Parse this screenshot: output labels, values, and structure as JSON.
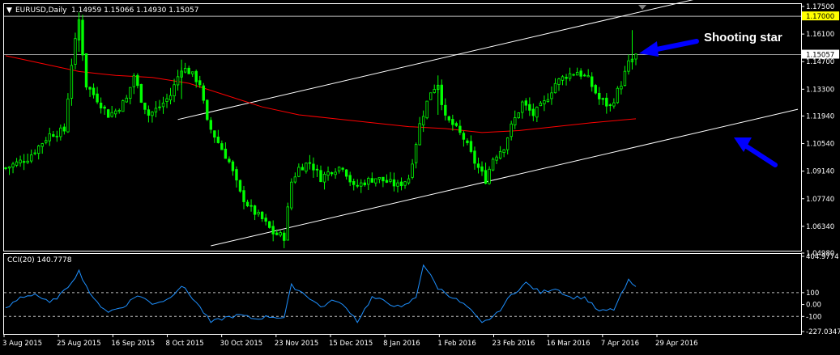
{
  "header": {
    "symbol": "EURUSD,Daily",
    "ohlc": "1.14959 1.15066 1.14930 1.15057"
  },
  "indicator": {
    "label": "CCI(20) 140.7778"
  },
  "annotation": {
    "text": "Shooting star"
  },
  "colors": {
    "background": "#000000",
    "candle": "#00ff00",
    "moving_average": "#ff0000",
    "cci_line": "#1e90ff",
    "channel": "#ffffff",
    "arrow": "#0000ff",
    "current_price_bg": "#ffffff",
    "level_price_bg": "#ffff00"
  },
  "chart_data": [
    {
      "type": "candlestick",
      "y_ticks": [
        "1.17500",
        "1.16100",
        "1.14700",
        "1.13300",
        "1.11940",
        "1.10540",
        "1.09140",
        "1.07740",
        "1.06340",
        "1.04980"
      ],
      "y_tick_values": [
        1.175,
        1.161,
        1.147,
        1.133,
        1.1194,
        1.1054,
        1.0914,
        1.0774,
        1.0634,
        1.0498
      ],
      "ylim": [
        1.0498,
        1.175
      ],
      "x_ticks": [
        "3 Aug 2015",
        "25 Aug 2015",
        "16 Sep 2015",
        "8 Oct 2015",
        "30 Oct 2015",
        "23 Nov 2015",
        "15 Dec 2015",
        "8 Jan 2016",
        "1 Feb 2016",
        "23 Feb 2016",
        "16 Mar 2016",
        "7 Apr 2016",
        "29 Apr 2016"
      ],
      "current_price": {
        "label": "1.15057",
        "value": 1.15057
      },
      "level_line": {
        "label": "1.17000",
        "value": 1.17
      },
      "price_path": [
        [
          0,
          1.093
        ],
        [
          6,
          1.098
        ],
        [
          12,
          1.11
        ],
        [
          16,
          1.112
        ],
        [
          18,
          1.146
        ],
        [
          20,
          1.168
        ],
        [
          22,
          1.135
        ],
        [
          25,
          1.128
        ],
        [
          28,
          1.12
        ],
        [
          30,
          1.122
        ],
        [
          33,
          1.128
        ],
        [
          35,
          1.14
        ],
        [
          37,
          1.128
        ],
        [
          39,
          1.12
        ],
        [
          42,
          1.124
        ],
        [
          45,
          1.13
        ],
        [
          48,
          1.144
        ],
        [
          50,
          1.142
        ],
        [
          53,
          1.136
        ],
        [
          55,
          1.116
        ],
        [
          58,
          1.106
        ],
        [
          61,
          1.096
        ],
        [
          64,
          1.08
        ],
        [
          67,
          1.072
        ],
        [
          70,
          1.067
        ],
        [
          73,
          1.06
        ],
        [
          76,
          1.058
        ],
        [
          78,
          1.086
        ],
        [
          80,
          1.093
        ],
        [
          83,
          1.096
        ],
        [
          86,
          1.088
        ],
        [
          89,
          1.092
        ],
        [
          92,
          1.094
        ],
        [
          95,
          1.083
        ],
        [
          98,
          1.086
        ],
        [
          101,
          1.088
        ],
        [
          104,
          1.086
        ],
        [
          107,
          1.084
        ],
        [
          110,
          1.088
        ],
        [
          113,
          1.115
        ],
        [
          116,
          1.132
        ],
        [
          118,
          1.136
        ],
        [
          120,
          1.118
        ],
        [
          122,
          1.115
        ],
        [
          125,
          1.108
        ],
        [
          128,
          1.096
        ],
        [
          131,
          1.087
        ],
        [
          133,
          1.098
        ],
        [
          136,
          1.104
        ],
        [
          138,
          1.114
        ],
        [
          141,
          1.126
        ],
        [
          144,
          1.12
        ],
        [
          147,
          1.126
        ],
        [
          150,
          1.136
        ],
        [
          153,
          1.14
        ],
        [
          156,
          1.142
        ],
        [
          159,
          1.138
        ],
        [
          162,
          1.128
        ],
        [
          165,
          1.124
        ],
        [
          168,
          1.136
        ],
        [
          170,
          1.146
        ],
        [
          172,
          1.15
        ]
      ],
      "moving_average_path": [
        [
          0,
          1.15
        ],
        [
          10,
          1.146
        ],
        [
          20,
          1.142
        ],
        [
          30,
          1.14
        ],
        [
          40,
          1.139
        ],
        [
          50,
          1.136
        ],
        [
          60,
          1.13
        ],
        [
          70,
          1.124
        ],
        [
          80,
          1.12
        ],
        [
          90,
          1.118
        ],
        [
          100,
          1.116
        ],
        [
          110,
          1.114
        ],
        [
          120,
          1.113
        ],
        [
          130,
          1.111
        ],
        [
          140,
          1.112
        ],
        [
          150,
          1.114
        ],
        [
          160,
          1.116
        ],
        [
          172,
          1.118
        ]
      ]
    },
    {
      "type": "line",
      "name": "CCI(20)",
      "y_ticks": [
        "404.9774",
        "100",
        "0.00",
        "-100",
        "-227.0347"
      ],
      "y_tick_values": [
        404.9774,
        100,
        0,
        -100,
        -227.0347
      ],
      "ylim": [
        -227.0347,
        404.9774
      ],
      "dashed_levels": [
        100,
        -100
      ],
      "path": [
        [
          0,
          -40
        ],
        [
          4,
          60
        ],
        [
          8,
          90
        ],
        [
          12,
          10
        ],
        [
          16,
          110
        ],
        [
          20,
          280
        ],
        [
          24,
          40
        ],
        [
          28,
          -60
        ],
        [
          32,
          -20
        ],
        [
          36,
          80
        ],
        [
          40,
          10
        ],
        [
          44,
          40
        ],
        [
          48,
          160
        ],
        [
          52,
          20
        ],
        [
          56,
          -150
        ],
        [
          60,
          -110
        ],
        [
          64,
          -90
        ],
        [
          68,
          -120
        ],
        [
          72,
          -100
        ],
        [
          76,
          -110
        ],
        [
          78,
          160
        ],
        [
          82,
          80
        ],
        [
          86,
          -20
        ],
        [
          90,
          40
        ],
        [
          94,
          -60
        ],
        [
          96,
          -140
        ],
        [
          100,
          60
        ],
        [
          104,
          20
        ],
        [
          108,
          -30
        ],
        [
          112,
          60
        ],
        [
          114,
          340
        ],
        [
          118,
          140
        ],
        [
          122,
          60
        ],
        [
          126,
          -20
        ],
        [
          130,
          -160
        ],
        [
          134,
          -80
        ],
        [
          138,
          80
        ],
        [
          142,
          180
        ],
        [
          146,
          100
        ],
        [
          150,
          140
        ],
        [
          154,
          60
        ],
        [
          158,
          60
        ],
        [
          162,
          -60
        ],
        [
          166,
          -40
        ],
        [
          170,
          200
        ],
        [
          172,
          140
        ]
      ]
    }
  ]
}
